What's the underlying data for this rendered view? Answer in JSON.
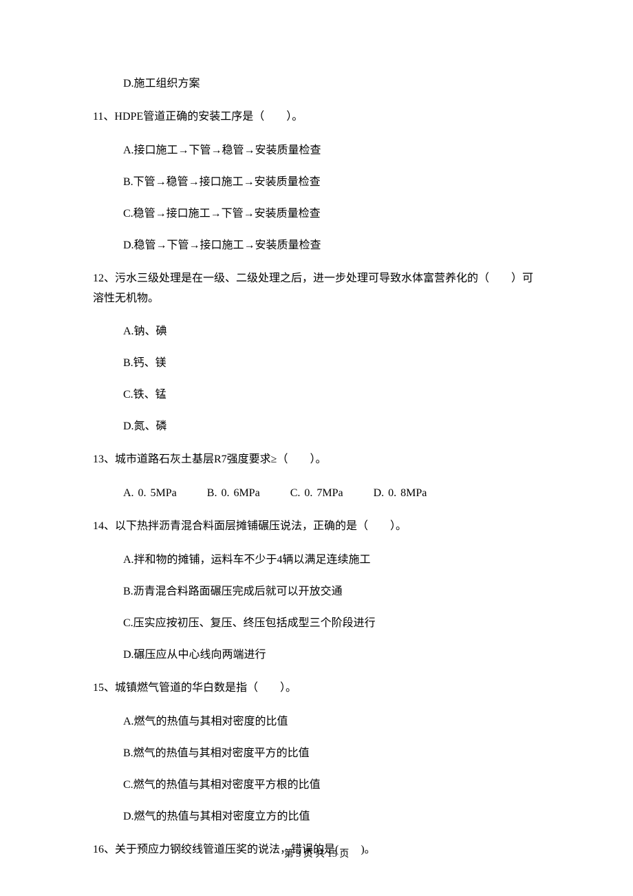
{
  "q10_opt_d": "D.施工组织方案",
  "q11": "11、HDPE管道正确的安装工序是（　　）。",
  "q11_a": "A.接口施工→下管→稳管→安装质量检查",
  "q11_b": "B.下管→稳管→接口施工→安装质量检查",
  "q11_c": "C.稳管→接口施工→下管→安装质量检查",
  "q11_d": "D.稳管→下管→接口施工→安装质量检查",
  "q12": "12、污水三级处理是在一级、二级处理之后，进一步处理可导致水体富营养化的（　　）可溶性无机物。",
  "q12_a": "A.钠、碘",
  "q12_b": "B.钙、镁",
  "q12_c": "C.铁、锰",
  "q12_d": "D.氮、磷",
  "q13": "13、城市道路石灰土基层R7强度要求≥（　　）。",
  "q13_a": "A. 0. 5MPa",
  "q13_b": "B. 0. 6MPa",
  "q13_c": "C. 0. 7MPa",
  "q13_d": "D. 0. 8MPa",
  "q14": "14、以下热拌沥青混合料面层摊铺碾压说法，正确的是（　　）。",
  "q14_a": "A.拌和物的摊铺，运料车不少于4辆以满足连续施工",
  "q14_b": "B.沥青混合料路面碾压完成后就可以开放交通",
  "q14_c": "C.压实应按初压、复压、终压包括成型三个阶段进行",
  "q14_d": "D.碾压应从中心线向两端进行",
  "q15": "15、城镇燃气管道的华白数是指（　　）。",
  "q15_a": "A.燃气的热值与其相对密度的比值",
  "q15_b": "B.燃气的热值与其相对密度平方的比值",
  "q15_c": "C.燃气的热值与其相对密度平方根的比值",
  "q15_d": "D.燃气的热值与其相对密度立方的比值",
  "q16": "16、关于预应力钢绞线管道压奖的说法，错误的是(　　)。",
  "footer": "第 3 页 共 15 页"
}
